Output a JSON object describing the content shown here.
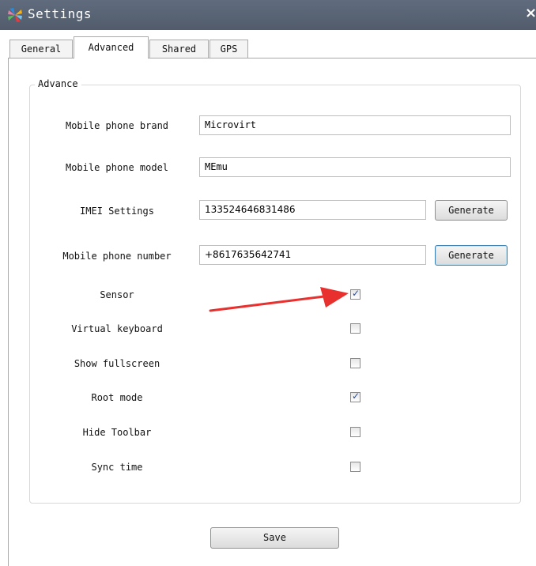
{
  "window": {
    "title": "Settings",
    "close_glyph": "×"
  },
  "tabs": [
    {
      "label": "General",
      "active": false
    },
    {
      "label": "Advanced",
      "active": true
    },
    {
      "label": "Shared",
      "active": false
    },
    {
      "label": "GPS",
      "active": false
    }
  ],
  "group": {
    "title": "Advance"
  },
  "fields": {
    "brand": {
      "label": "Mobile phone brand",
      "value": "Microvirt"
    },
    "model": {
      "label": "Mobile phone model",
      "value": "MEmu"
    },
    "imei": {
      "label": "IMEI Settings",
      "value": "133524646831486",
      "button": "Generate"
    },
    "phone": {
      "label": "Mobile phone number",
      "value": "+8617635642741",
      "button": "Generate"
    }
  },
  "options": {
    "sensor": {
      "label": "Sensor",
      "checked": true
    },
    "virtual_keyboard": {
      "label": "Virtual keyboard",
      "checked": false
    },
    "show_fullscreen": {
      "label": "Show fullscreen",
      "checked": false
    },
    "root_mode": {
      "label": "Root mode",
      "checked": true
    },
    "hide_toolbar": {
      "label": "Hide Toolbar",
      "checked": false
    },
    "sync_time": {
      "label": "Sync time",
      "checked": false
    }
  },
  "save_label": "Save",
  "check_glyph": "✓",
  "colors": {
    "titlebar": "#5b6577",
    "arrow": "#e8302e",
    "check": "#2a4d9c"
  },
  "icons": {
    "app": "memu-pinwheel-icon",
    "close": "close-icon",
    "annotation": "red-arrow"
  }
}
